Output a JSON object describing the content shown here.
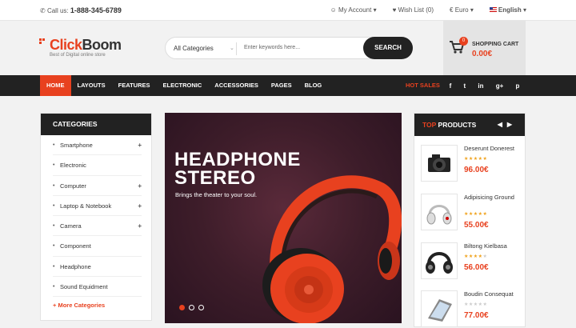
{
  "topbar": {
    "call_label": "Call us:",
    "phone": "1-888-345-6789",
    "account": "My Account",
    "wishlist": "Wish List (0)",
    "currency": "€ Euro",
    "language": "English"
  },
  "logo": {
    "name_part1": "Click",
    "name_part2": "Boom",
    "tagline": "Best of Digital online store"
  },
  "search": {
    "category": "All Categories",
    "placeholder": "Enter keywords here...",
    "button": "SEARCH"
  },
  "cart": {
    "count": "0",
    "label": "SHOPPING CART",
    "amount": "0.00€"
  },
  "nav": {
    "items": [
      "HOME",
      "LAYOUTS",
      "FEATURES",
      "ELECTRONIC",
      "ACCESSORIES",
      "PAGES",
      "BLOG"
    ],
    "hot_sales": "HOT SALES",
    "social": [
      "f",
      "t",
      "in",
      "g+",
      "p"
    ]
  },
  "categories": {
    "title": "CATEGORIES",
    "items": [
      {
        "label": "Smartphone",
        "plus": "+"
      },
      {
        "label": "Electronic",
        "plus": ""
      },
      {
        "label": "Computer",
        "plus": "+"
      },
      {
        "label": "Laptop & Notebook",
        "plus": "+"
      },
      {
        "label": "Camera",
        "plus": "+"
      },
      {
        "label": "Component",
        "plus": ""
      },
      {
        "label": "Headphone",
        "plus": ""
      },
      {
        "label": "Sound Equidment",
        "plus": ""
      }
    ],
    "more": "+ More Categories"
  },
  "banner": {
    "title_line1": "HEADPHONE",
    "title_line2": "STEREO",
    "subtitle": "Brings the theater to your soul.",
    "colors": {
      "accent": "#e8411f"
    }
  },
  "top_products": {
    "title_hl": "TOP",
    "title_rest": "PRODUCTS",
    "items": [
      {
        "name": "Deserunt Donerest",
        "rating": 5,
        "price": "96.00€",
        "icon": "camera-icon"
      },
      {
        "name": "Adipisicing Ground",
        "rating": 5,
        "price": "55.00€",
        "icon": "headphones-icon"
      },
      {
        "name": "Biltong Kielbasa",
        "rating": 4,
        "price": "56.00€",
        "icon": "headphones-icon"
      },
      {
        "name": "Boudin Consequat",
        "rating": 0,
        "price": "77.00€",
        "icon": "tablet-icon"
      }
    ]
  }
}
